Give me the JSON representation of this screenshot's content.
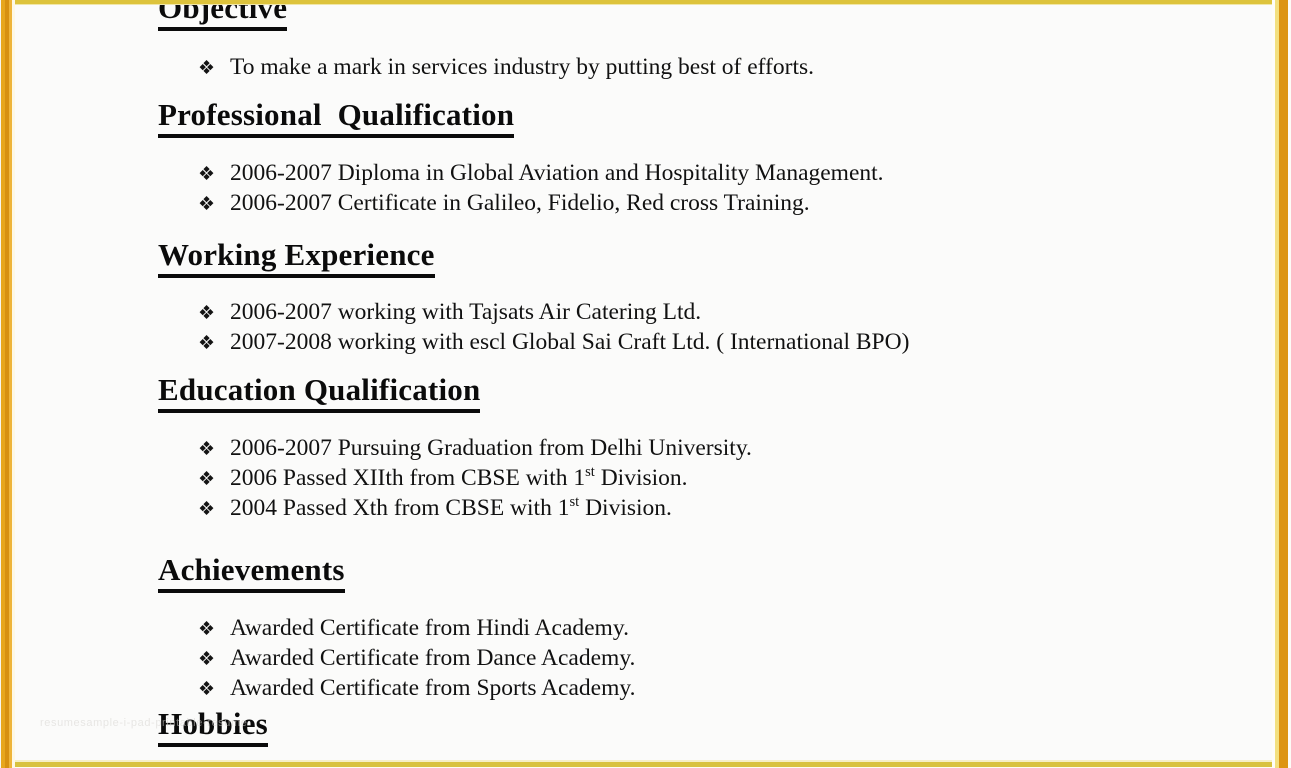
{
  "document": {
    "type": "resume-scan",
    "background_color": "#fbfbfa",
    "text_color": "#111111",
    "border_color": "#e7a61c",
    "border_accent_color": "#ddc33c",
    "bullet_glyph": "❖",
    "watermark_text": "resumesample-i-pad-printable-resume"
  },
  "sections": [
    {
      "id": "objective",
      "heading": "Objective",
      "items": [
        {
          "text": "To make a mark in services industry by putting best of efforts."
        }
      ]
    },
    {
      "id": "professional-qualification",
      "heading": "Professional  Qualification",
      "items": [
        {
          "text": "2006-2007 Diploma in Global Aviation and Hospitality Management."
        },
        {
          "text": "2006-2007 Certificate in Galileo, Fidelio, Red cross Training."
        }
      ]
    },
    {
      "id": "working-experience",
      "heading": "Working Experience",
      "items": [
        {
          "text": "2006-2007 working with Tajsats Air Catering Ltd."
        },
        {
          "text": "2007-2008 working with escl Global Sai Craft Ltd. ( International BPO)"
        }
      ]
    },
    {
      "id": "education-qualification",
      "heading": "Education Qualification",
      "items": [
        {
          "text": "2006-2007 Pursuing Graduation from Delhi University."
        },
        {
          "pre": "2006 Passed XIIth from CBSE with 1",
          "sup": "st",
          "post": " Division."
        },
        {
          "pre": "2004 Passed Xth from CBSE with 1",
          "sup": "st",
          "post": " Division."
        }
      ]
    },
    {
      "id": "achievements",
      "heading": "Achievements",
      "items": [
        {
          "text": "Awarded Certificate from Hindi Academy."
        },
        {
          "text": "Awarded Certificate from Dance Academy."
        },
        {
          "text": "Awarded Certificate from Sports Academy."
        }
      ]
    },
    {
      "id": "hobbies",
      "heading": "Hobbies",
      "items": []
    }
  ]
}
